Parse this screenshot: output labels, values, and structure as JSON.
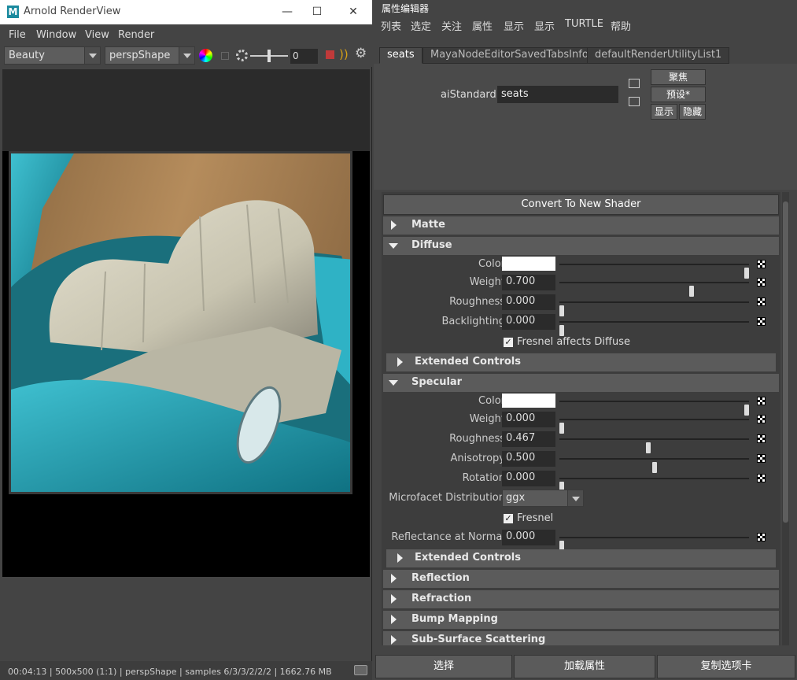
{
  "render_view": {
    "title": "Arnold RenderView",
    "logo": "M",
    "window_controls": {
      "minimize": "—",
      "maximize": "☐",
      "close": "✕"
    },
    "menu": [
      "File",
      "Window",
      "View",
      "Render"
    ],
    "toolbar": {
      "aov_dropdown": "Beauty",
      "camera_dropdown": "perspShape",
      "exposure_value": "0"
    },
    "status": "00:04:13 | 500x500 (1:1) | perspShape | samples 6/3/3/2/2/2 | 1662.76 MB"
  },
  "attribute_editor": {
    "title": "属性编辑器",
    "menu": [
      "列表",
      "选定",
      "关注",
      "属性",
      "显示",
      "显示",
      "TURTLE",
      "帮助"
    ],
    "tabs": [
      "seats",
      "MayaNodeEditorSavedTabsInfo",
      "defaultRenderUtilityList1"
    ],
    "node_type_label": "aiStandard:",
    "node_name": "seats",
    "buttons": {
      "focus": "聚焦",
      "presets": "预设*",
      "show": "显示",
      "hide": "隐藏"
    },
    "convert_button": "Convert To New Shader",
    "sections": {
      "matte": "Matte",
      "diffuse": "Diffuse",
      "diffuse_extended": "Extended Controls",
      "specular": "Specular",
      "specular_extended": "Extended Controls",
      "reflection": "Reflection",
      "refraction": "Refraction",
      "bump": "Bump Mapping",
      "sss": "Sub-Surface Scattering"
    },
    "diffuse": {
      "color_label": "Color",
      "color": "#ffffff",
      "color_level": 1.0,
      "weight_label": "Weight",
      "weight": "0.700",
      "roughness_label": "Roughness",
      "roughness": "0.000",
      "backlighting_label": "Backlighting",
      "backlighting": "0.000",
      "fresnel_label": "Fresnel affects Diffuse",
      "fresnel_checked": true
    },
    "specular": {
      "color_label": "Color",
      "color": "#ffffff",
      "color_level": 1.0,
      "weight_label": "Weight",
      "weight": "0.000",
      "roughness_label": "Roughness",
      "roughness": "0.467",
      "anisotropy_label": "Anisotropy",
      "anisotropy": "0.500",
      "rotation_label": "Rotation",
      "rotation": "0.000",
      "microfacet_label": "Microfacet Distribution",
      "microfacet": "ggx",
      "fresnel_label": "Fresnel",
      "fresnel_checked": true,
      "reflectance_label": "Reflectance at Normal",
      "reflectance": "0.000"
    },
    "footer": {
      "select": "选择",
      "load_attributes": "加载属性",
      "copy_tab": "复制选项卡"
    }
  }
}
